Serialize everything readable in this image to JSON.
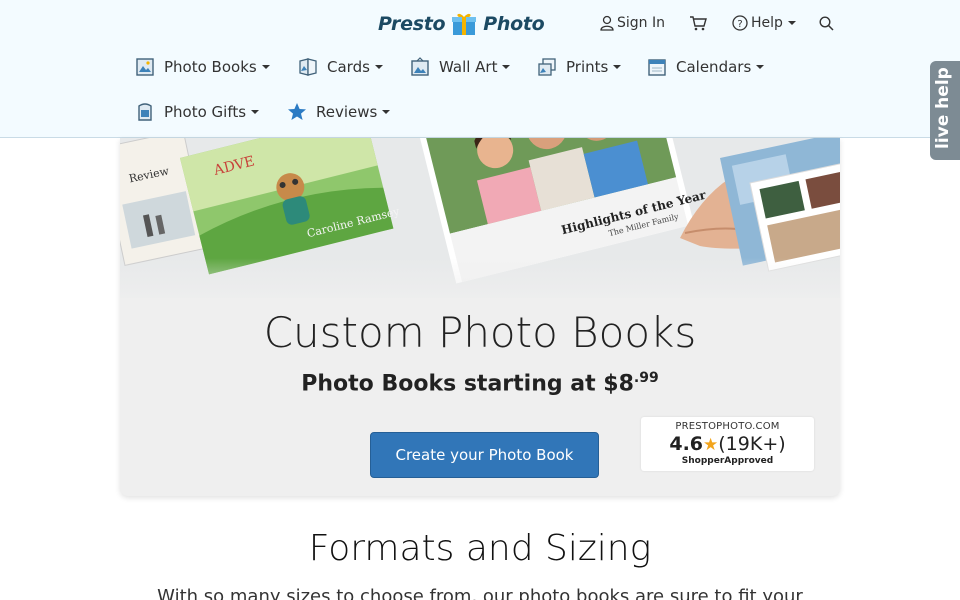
{
  "header": {
    "logo_left": "Presto",
    "logo_right": "Photo",
    "sign_in": "Sign In",
    "help": "Help"
  },
  "nav": [
    {
      "label": "Photo Books",
      "icon": "photo-book-icon"
    },
    {
      "label": "Cards",
      "icon": "card-icon"
    },
    {
      "label": "Wall Art",
      "icon": "wall-art-icon"
    },
    {
      "label": "Prints",
      "icon": "prints-icon"
    },
    {
      "label": "Calendars",
      "icon": "calendar-icon"
    },
    {
      "label": "Photo Gifts",
      "icon": "photo-gift-icon"
    },
    {
      "label": "Reviews",
      "icon": "star-icon"
    }
  ],
  "live_help": "live help",
  "hero": {
    "title": "Custom Photo Books",
    "subtitle_prefix": "Photo Books starting at $8",
    "subtitle_cents": ".99",
    "cta": "Create your Photo Book",
    "rating_site": "PRESTOPHOTO.COM",
    "rating_value": "4.6",
    "rating_count": "(19K+)",
    "rating_brand": "ShopperApproved",
    "book_title": "Highlights of the Year",
    "book_subtitle": "The Miller Family",
    "book2_title": "Caroline Ramsey",
    "book3_title": "Review"
  },
  "section": {
    "title": "Formats and Sizing",
    "text": "With so many sizes to choose from, our photo books are sure to fit your"
  },
  "colors": {
    "header_bg": "#f3fbff",
    "cta": "#3176b8",
    "logo": "#1c4a63",
    "star": "#f2a41c",
    "live_help": "#7d8b94"
  }
}
